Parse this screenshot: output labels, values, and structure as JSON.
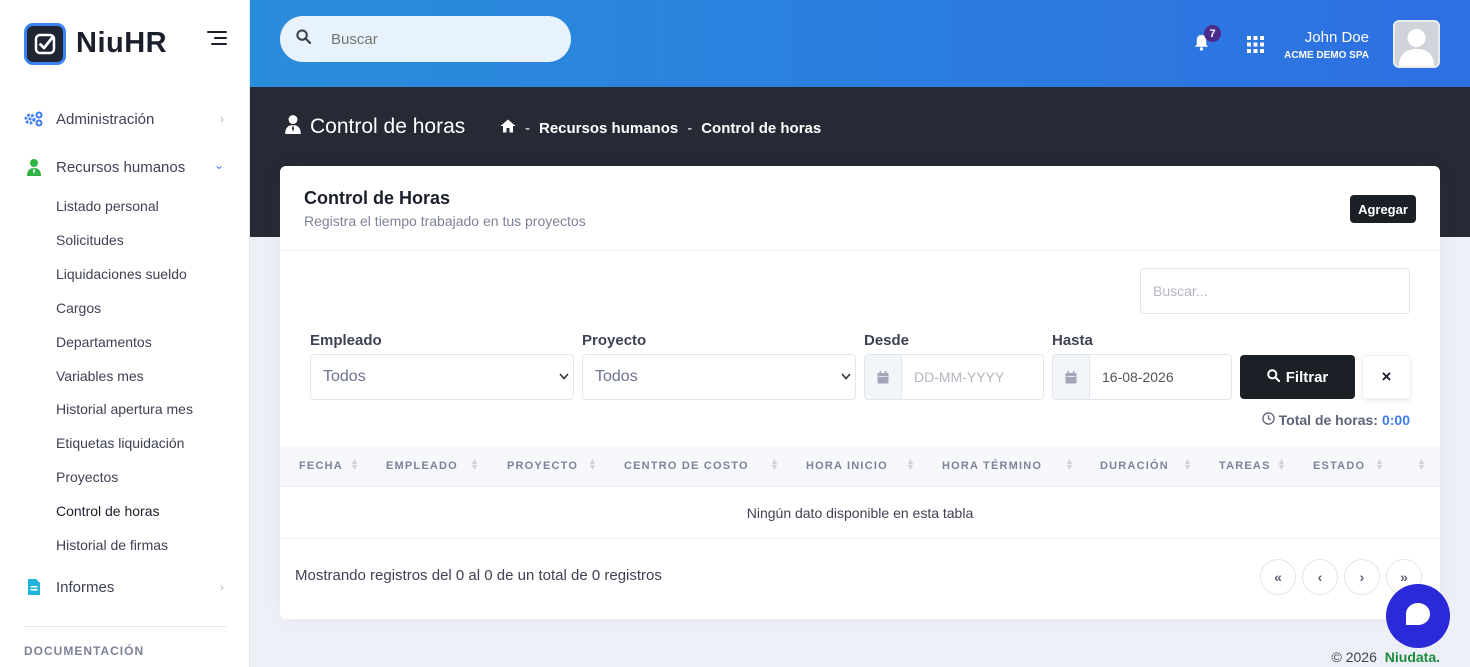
{
  "brand": {
    "name": "NiuHR"
  },
  "sidebar": {
    "items": [
      {
        "label": "Administración"
      },
      {
        "label": "Recursos humanos"
      },
      {
        "label": "Informes"
      }
    ],
    "submenu": [
      {
        "label": "Listado personal"
      },
      {
        "label": "Solicitudes"
      },
      {
        "label": "Liquidaciones sueldo"
      },
      {
        "label": "Cargos"
      },
      {
        "label": "Departamentos"
      },
      {
        "label": "Variables mes"
      },
      {
        "label": "Historial apertura mes"
      },
      {
        "label": "Etiquetas liquidación"
      },
      {
        "label": "Proyectos"
      },
      {
        "label": "Control de horas"
      },
      {
        "label": "Historial de firmas"
      }
    ],
    "section_title": "DOCUMENTACIÓN"
  },
  "header": {
    "search_placeholder": "Buscar",
    "notifications_count": "7",
    "user_name": "John Doe",
    "user_company": "ACME DEMO SPA"
  },
  "subheader": {
    "title": "Control de horas",
    "breadcrumb": [
      "Recursos humanos",
      "Control de horas"
    ],
    "breadcrumb_sep": "-"
  },
  "card": {
    "title": "Control de Horas",
    "subtitle": "Registra el tiempo trabajado en tus proyectos",
    "add_label": "Agregar",
    "table_search_placeholder": "Buscar...",
    "filters": {
      "empleado_label": "Empleado",
      "empleado_value": "Todos",
      "proyecto_label": "Proyecto",
      "proyecto_value": "Todos",
      "desde_label": "Desde",
      "desde_placeholder": "DD-MM-YYYY",
      "hasta_label": "Hasta",
      "hasta_value": "16-08-2026",
      "filter_label": "Filtrar",
      "clear_label": "×"
    },
    "total_label": "Total de horas:",
    "total_value": "0:00",
    "columns": [
      "FECHA",
      "EMPLEADO",
      "PROYECTO",
      "CENTRO DE COSTO",
      "HORA INICIO",
      "HORA TÉRMINO",
      "DURACIÓN",
      "TAREAS",
      "ESTADO"
    ],
    "empty_text": "Ningún dato disponible en esta tabla",
    "showing_text": "Mostrando registros del 0 al 0 de un total de 0 registros",
    "pagination": [
      "«",
      "‹",
      "›",
      "»"
    ]
  },
  "footer": {
    "year": "© 2026",
    "brand": "Niudata."
  },
  "colors": {
    "accent": "#3f7cf5",
    "topbar": "#2b7fdf",
    "subheader": "#262a35",
    "dark_button": "#1b1f26",
    "chat": "#2a2ad8",
    "footer_brand": "#1b8a3a"
  }
}
